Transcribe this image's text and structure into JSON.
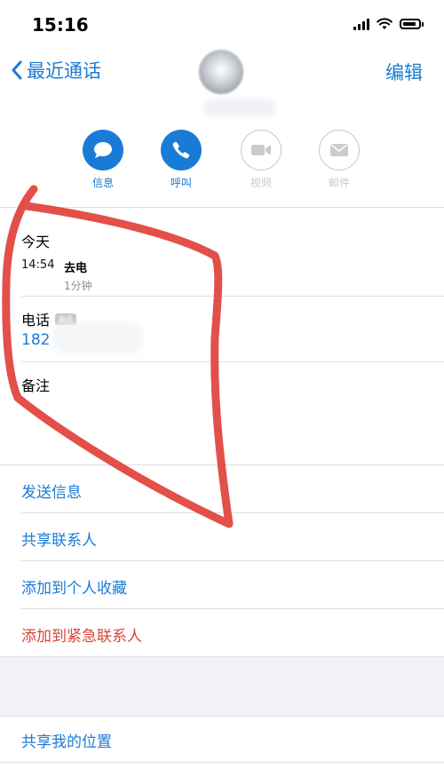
{
  "status_bar": {
    "time": "15:16"
  },
  "nav": {
    "back_label": "最近通话",
    "edit_label": "编辑"
  },
  "actions": [
    {
      "label": "信息",
      "icon": "message-icon",
      "enabled": true
    },
    {
      "label": "呼叫",
      "icon": "phone-icon",
      "enabled": true
    },
    {
      "label": "视频",
      "icon": "video-icon",
      "enabled": false
    },
    {
      "label": "邮件",
      "icon": "mail-icon",
      "enabled": false
    }
  ],
  "recent": {
    "title": "今天",
    "time": "14:54",
    "type": "去电",
    "duration": "1分钟"
  },
  "phone": {
    "label": "电话",
    "badge": "最近",
    "number": "182"
  },
  "notes": {
    "label": "备注"
  },
  "links": [
    {
      "label": "发送信息"
    },
    {
      "label": "共享联系人"
    },
    {
      "label": "添加到个人收藏"
    },
    {
      "label": "添加到紧急联系人"
    }
  ],
  "location": {
    "label": "共享我的位置"
  },
  "colors": {
    "accent": "#1a7bd6",
    "danger": "#d9453a",
    "annotation": "#e0413a"
  }
}
